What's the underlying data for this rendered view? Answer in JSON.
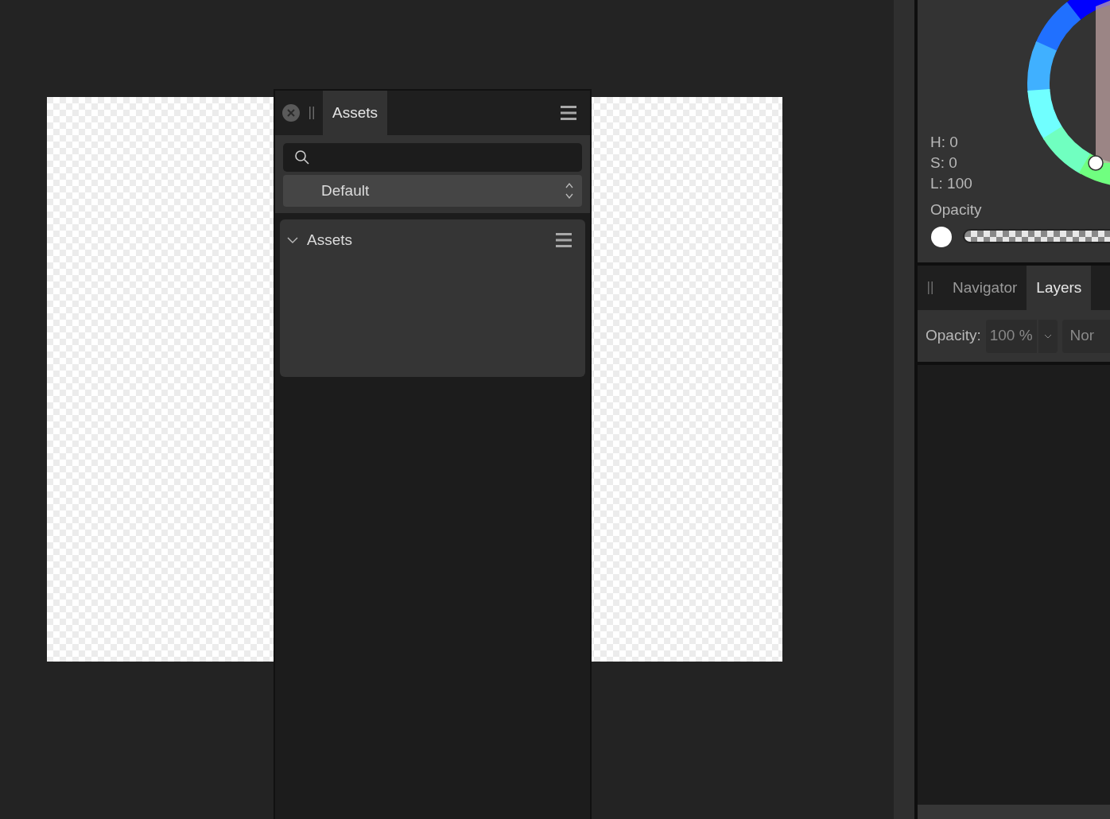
{
  "assets_panel": {
    "tabs": [
      {
        "label": "Assets",
        "selected": true
      }
    ],
    "category": {
      "value": "Default"
    },
    "sections": [
      {
        "title": "Assets",
        "expanded": true
      }
    ]
  },
  "color_panel": {
    "readouts": [
      "H: 0",
      "S: 0",
      "L: 100"
    ],
    "opacity_label": "Opacity"
  },
  "layers_panel": {
    "tabs": [
      {
        "label": "Navigator",
        "selected": false
      },
      {
        "label": "Layers",
        "selected": true
      }
    ],
    "opacity_label": "Opacity:",
    "opacity_value": "100 %",
    "blend_mode": "Nor"
  }
}
